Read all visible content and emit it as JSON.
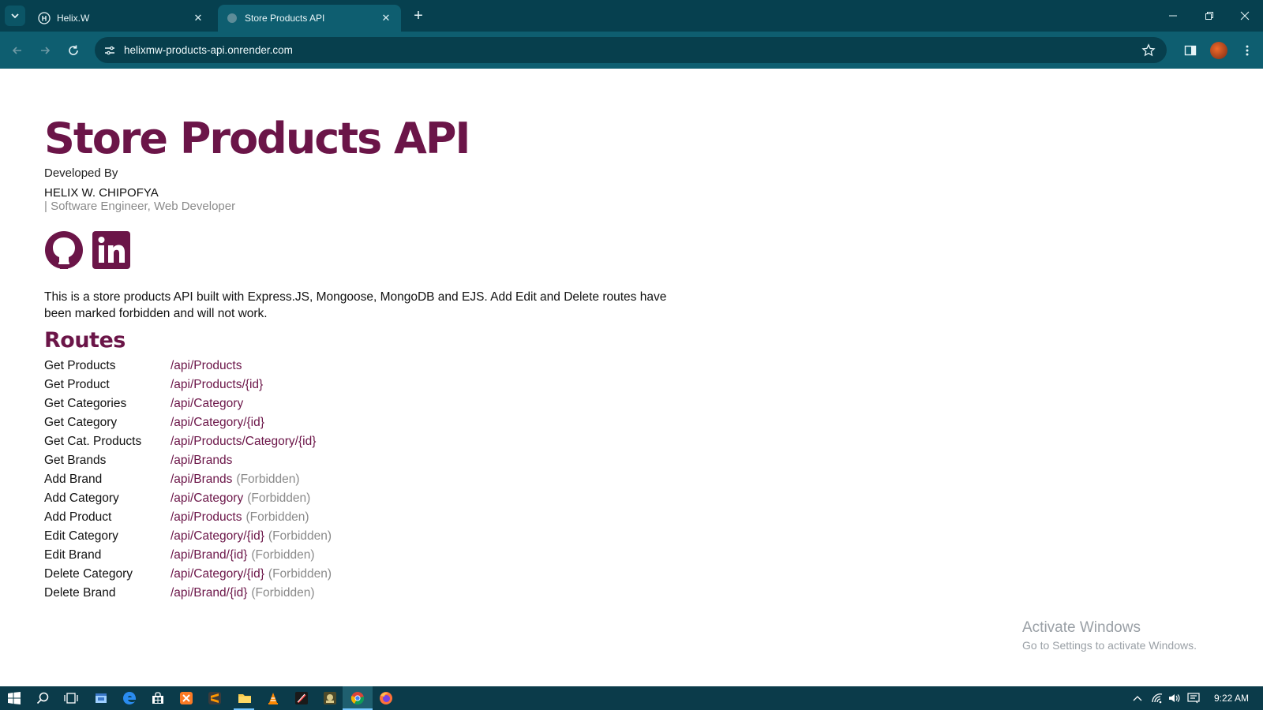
{
  "browser": {
    "tabs": [
      {
        "title": "Helix.W",
        "active": false
      },
      {
        "title": "Store Products API",
        "active": true
      }
    ],
    "url": "helixmw-products-api.onrender.com"
  },
  "page": {
    "title": "Store Products API",
    "developed_by": "Developed By",
    "author": "HELIX W. CHIPOFYA",
    "role": "| Software Engineer, Web Developer",
    "description": "This is a store products API built with Express.JS, Mongoose, MongoDB and EJS. Add Edit and Delete routes have been marked forbidden and will not work.",
    "routes_heading": "Routes",
    "routes": [
      {
        "name": "Get Products",
        "path": "/api/Products",
        "note": ""
      },
      {
        "name": "Get Product",
        "path": "/api/Products/{id}",
        "note": ""
      },
      {
        "name": "Get Categories",
        "path": "/api/Category",
        "note": ""
      },
      {
        "name": "Get Category",
        "path": "/api/Category/{id}",
        "note": ""
      },
      {
        "name": "Get Cat. Products",
        "path": "/api/Products/Category/{id}",
        "note": ""
      },
      {
        "name": "Get Brands",
        "path": "/api/Brands",
        "note": ""
      },
      {
        "name": "Add Brand",
        "path": "/api/Brands",
        "note": "(Forbidden)"
      },
      {
        "name": "Add Category",
        "path": "/api/Category",
        "note": "(Forbidden)"
      },
      {
        "name": "Add Product",
        "path": "/api/Products",
        "note": "(Forbidden)"
      },
      {
        "name": "Edit Category",
        "path": "/api/Category/{id}",
        "note": "(Forbidden)"
      },
      {
        "name": "Edit Brand",
        "path": "/api/Brand/{id}",
        "note": "(Forbidden)"
      },
      {
        "name": "Delete Category",
        "path": "/api/Category/{id}",
        "note": "(Forbidden)"
      },
      {
        "name": "Delete Brand",
        "path": "/api/Brand/{id}",
        "note": "(Forbidden)"
      }
    ],
    "social_icons": [
      "github-icon",
      "linkedin-icon"
    ]
  },
  "watermark": {
    "line1": "Activate Windows",
    "line2": "Go to Settings to activate Windows."
  },
  "taskbar": {
    "time": "9:22 AM"
  },
  "colors": {
    "brand": "#6b1548",
    "chrome_dark": "#06404f",
    "chrome_toolbar": "#0e5e70",
    "forbidden_text": "#8a8a8a"
  }
}
